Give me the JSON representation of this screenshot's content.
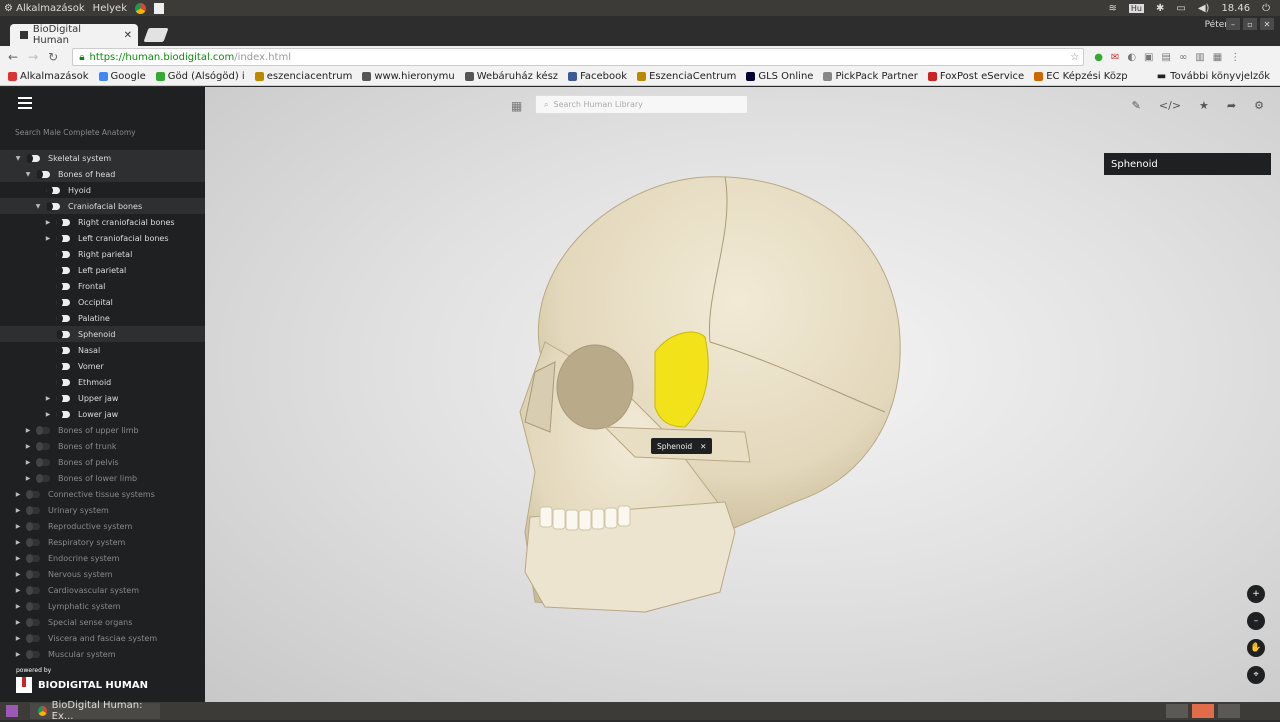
{
  "os": {
    "apps_menu": "Alkalmazások",
    "places_menu": "Helyek",
    "time": "18.46",
    "user": "Péter",
    "kbd": "Hu"
  },
  "browser": {
    "tab_title": "BioDigital Human",
    "url_host": "https://human.biodigital.com",
    "url_path": "/index.html",
    "bookmarks": [
      {
        "label": "Alkalmazások",
        "color": "#d33"
      },
      {
        "label": "Google",
        "color": "#4285f4"
      },
      {
        "label": "Göd (Alsógöd) i",
        "color": "#3a3"
      },
      {
        "label": "eszenciacentrum",
        "color": "#b80"
      },
      {
        "label": "www.hieronymu",
        "color": "#555"
      },
      {
        "label": "Webáruház kész",
        "color": "#555"
      },
      {
        "label": "Facebook",
        "color": "#3b5998"
      },
      {
        "label": "EszenciaCentrum",
        "color": "#b80"
      },
      {
        "label": "GLS Online",
        "color": "#003"
      },
      {
        "label": "PickPack Partner",
        "color": "#888"
      },
      {
        "label": "FoxPost eService",
        "color": "#c22"
      },
      {
        "label": "EC Képzési Közp",
        "color": "#c60"
      }
    ],
    "more_bookmarks": "További könyvjelzők"
  },
  "sidebar": {
    "search_placeholder": "Search Male Complete Anatomy",
    "tree": [
      {
        "label": "Skeletal system",
        "level": 0,
        "caret": "▼",
        "on": true,
        "hl": true
      },
      {
        "label": "Bones of head",
        "level": 1,
        "caret": "▼",
        "on": true,
        "hl": true
      },
      {
        "label": "Hyoid",
        "level": 2,
        "caret": "",
        "on": true
      },
      {
        "label": "Craniofacial bones",
        "level": 2,
        "caret": "▼",
        "on": true,
        "hl": true
      },
      {
        "label": "Right craniofacial bones",
        "level": 3,
        "caret": "▶",
        "on": true
      },
      {
        "label": "Left craniofacial bones",
        "level": 3,
        "caret": "▶",
        "on": true
      },
      {
        "label": "Right parietal",
        "level": 3,
        "caret": "",
        "on": true
      },
      {
        "label": "Left parietal",
        "level": 3,
        "caret": "",
        "on": true
      },
      {
        "label": "Frontal",
        "level": 3,
        "caret": "",
        "on": true
      },
      {
        "label": "Occipital",
        "level": 3,
        "caret": "",
        "on": true
      },
      {
        "label": "Palatine",
        "level": 3,
        "caret": "",
        "on": true
      },
      {
        "label": "Sphenoid",
        "level": 3,
        "caret": "",
        "on": true,
        "hl": true
      },
      {
        "label": "Nasal",
        "level": 3,
        "caret": "",
        "on": true
      },
      {
        "label": "Vomer",
        "level": 3,
        "caret": "",
        "on": true
      },
      {
        "label": "Ethmoid",
        "level": 3,
        "caret": "",
        "on": true
      },
      {
        "label": "Upper jaw",
        "level": 3,
        "caret": "▶",
        "on": true
      },
      {
        "label": "Lower jaw",
        "level": 3,
        "caret": "▶",
        "on": true
      },
      {
        "label": "Bones of upper limb",
        "level": 1,
        "caret": "▶",
        "on": false
      },
      {
        "label": "Bones of trunk",
        "level": 1,
        "caret": "▶",
        "on": false
      },
      {
        "label": "Bones of pelvis",
        "level": 1,
        "caret": "▶",
        "on": false
      },
      {
        "label": "Bones of lower limb",
        "level": 1,
        "caret": "▶",
        "on": false
      },
      {
        "label": "Connective tissue systems",
        "level": 0,
        "caret": "▶",
        "on": false
      },
      {
        "label": "Urinary system",
        "level": 0,
        "caret": "▶",
        "on": false
      },
      {
        "label": "Reproductive system",
        "level": 0,
        "caret": "▶",
        "on": false
      },
      {
        "label": "Respiratory system",
        "level": 0,
        "caret": "▶",
        "on": false
      },
      {
        "label": "Endocrine system",
        "level": 0,
        "caret": "▶",
        "on": false
      },
      {
        "label": "Nervous system",
        "level": 0,
        "caret": "▶",
        "on": false
      },
      {
        "label": "Cardiovascular system",
        "level": 0,
        "caret": "▶",
        "on": false
      },
      {
        "label": "Lymphatic system",
        "level": 0,
        "caret": "▶",
        "on": false
      },
      {
        "label": "Special sense organs",
        "level": 0,
        "caret": "▶",
        "on": false
      },
      {
        "label": "Viscera and fasciae system",
        "level": 0,
        "caret": "▶",
        "on": false
      },
      {
        "label": "Muscular system",
        "level": 0,
        "caret": "▶",
        "on": false
      }
    ],
    "powered_by": "powered by",
    "brand": "BIODIGITAL HUMAN"
  },
  "viewer": {
    "search_placeholder": "Search Human Library",
    "selected_label": "Sphenoid",
    "model_tag": "Sphenoid",
    "highlight_color": "#f2e21a"
  },
  "taskbar": {
    "window_title": "BioDigital Human: Ex..."
  }
}
